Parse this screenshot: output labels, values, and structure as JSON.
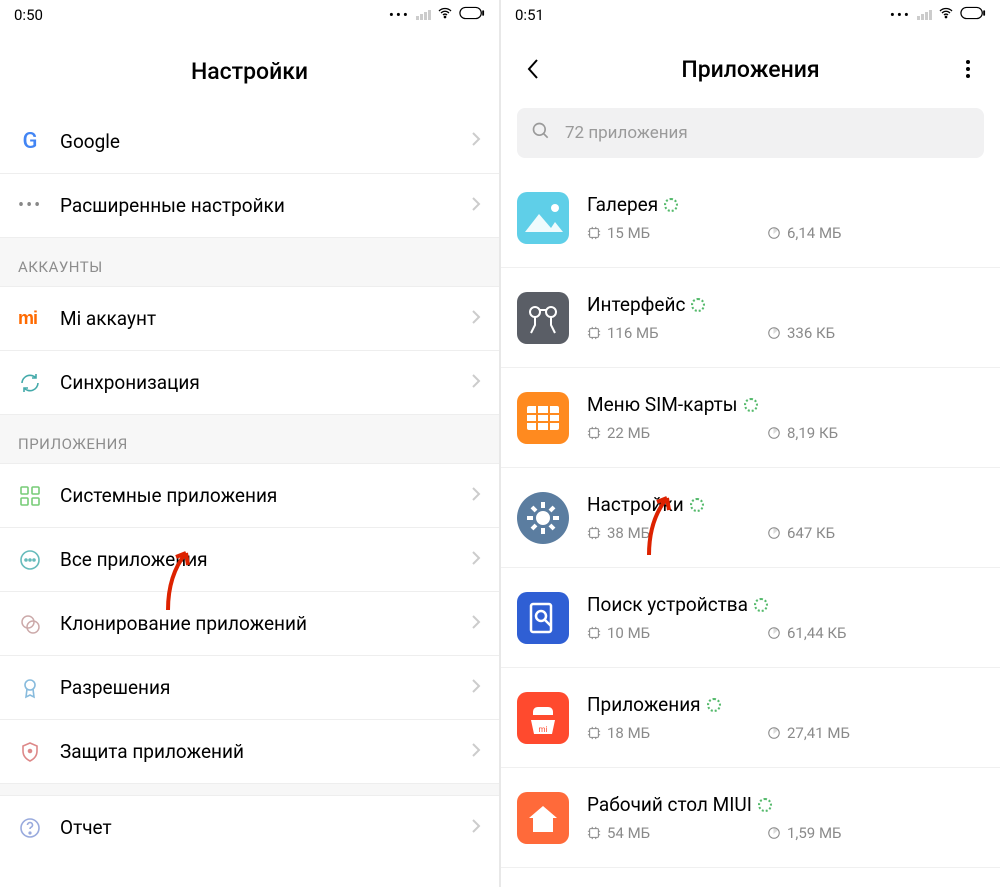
{
  "left": {
    "status_time": "0:50",
    "title": "Настройки",
    "rows": [
      {
        "label": "Google"
      },
      {
        "label": "Расширенные настройки"
      }
    ],
    "section_accounts": "АККАУНТЫ",
    "rows_accounts": [
      {
        "label": "Mi аккаунт"
      },
      {
        "label": "Синхронизация"
      }
    ],
    "section_apps": "ПРИЛОЖЕНИЯ",
    "rows_apps": [
      {
        "label": "Системные приложения"
      },
      {
        "label": "Все приложения"
      },
      {
        "label": "Клонирование приложений"
      },
      {
        "label": "Разрешения"
      },
      {
        "label": "Защита приложений"
      }
    ],
    "row_report": "Отчет"
  },
  "right": {
    "status_time": "0:51",
    "title": "Приложения",
    "search_placeholder": "72 приложения",
    "apps": [
      {
        "name": "Галерея",
        "storage": "15 МБ",
        "data": "6,14 МБ",
        "bg": "#5fcfe8"
      },
      {
        "name": "Интерфейс",
        "storage": "116 МБ",
        "data": "336 КБ",
        "bg": "#5a5e66"
      },
      {
        "name": "Меню SIM-карты",
        "storage": "22 МБ",
        "data": "8,19 КБ",
        "bg": "#ff8a1f"
      },
      {
        "name": "Настройки",
        "storage": "38 МБ",
        "data": "647 КБ",
        "bg": "#5b7da0"
      },
      {
        "name": "Поиск устройства",
        "storage": "10 МБ",
        "data": "61,44 КБ",
        "bg": "#2f5fd4"
      },
      {
        "name": "Приложения",
        "storage": "18 МБ",
        "data": "27,41 МБ",
        "bg": "#ff4a2e"
      },
      {
        "name": "Рабочий стол MIUI",
        "storage": "54 МБ",
        "data": "1,59 МБ",
        "bg": "#ff6a3a"
      }
    ]
  }
}
